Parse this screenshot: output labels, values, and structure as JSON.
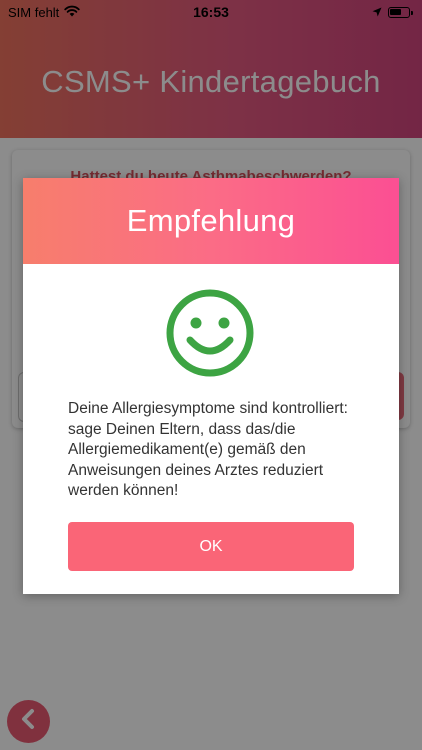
{
  "status_bar": {
    "carrier": "SIM fehlt",
    "time": "16:53"
  },
  "app": {
    "title": "CSMS+ Kindertagebuch"
  },
  "question": {
    "text": "Hattest du heute Asthmabeschwerden?"
  },
  "dialog": {
    "title": "Empfehlung",
    "icon": "smiley-face-icon",
    "message": "Deine Allergiesymptome sind kontrolliert: sage Deinen Eltern, dass das/die Allergiemedikament(e) gemäß den Anweisungen deines Arztes reduziert werden können!",
    "ok_label": "OK"
  },
  "colors": {
    "header_start": "#f0735f",
    "header_end": "#d2457f",
    "dialog_header_start": "#f77e6c",
    "dialog_header_end": "#fb4f93",
    "smiley_green": "#3da443",
    "ok_button": "#fa6577",
    "back_button": "#ea5a72"
  }
}
